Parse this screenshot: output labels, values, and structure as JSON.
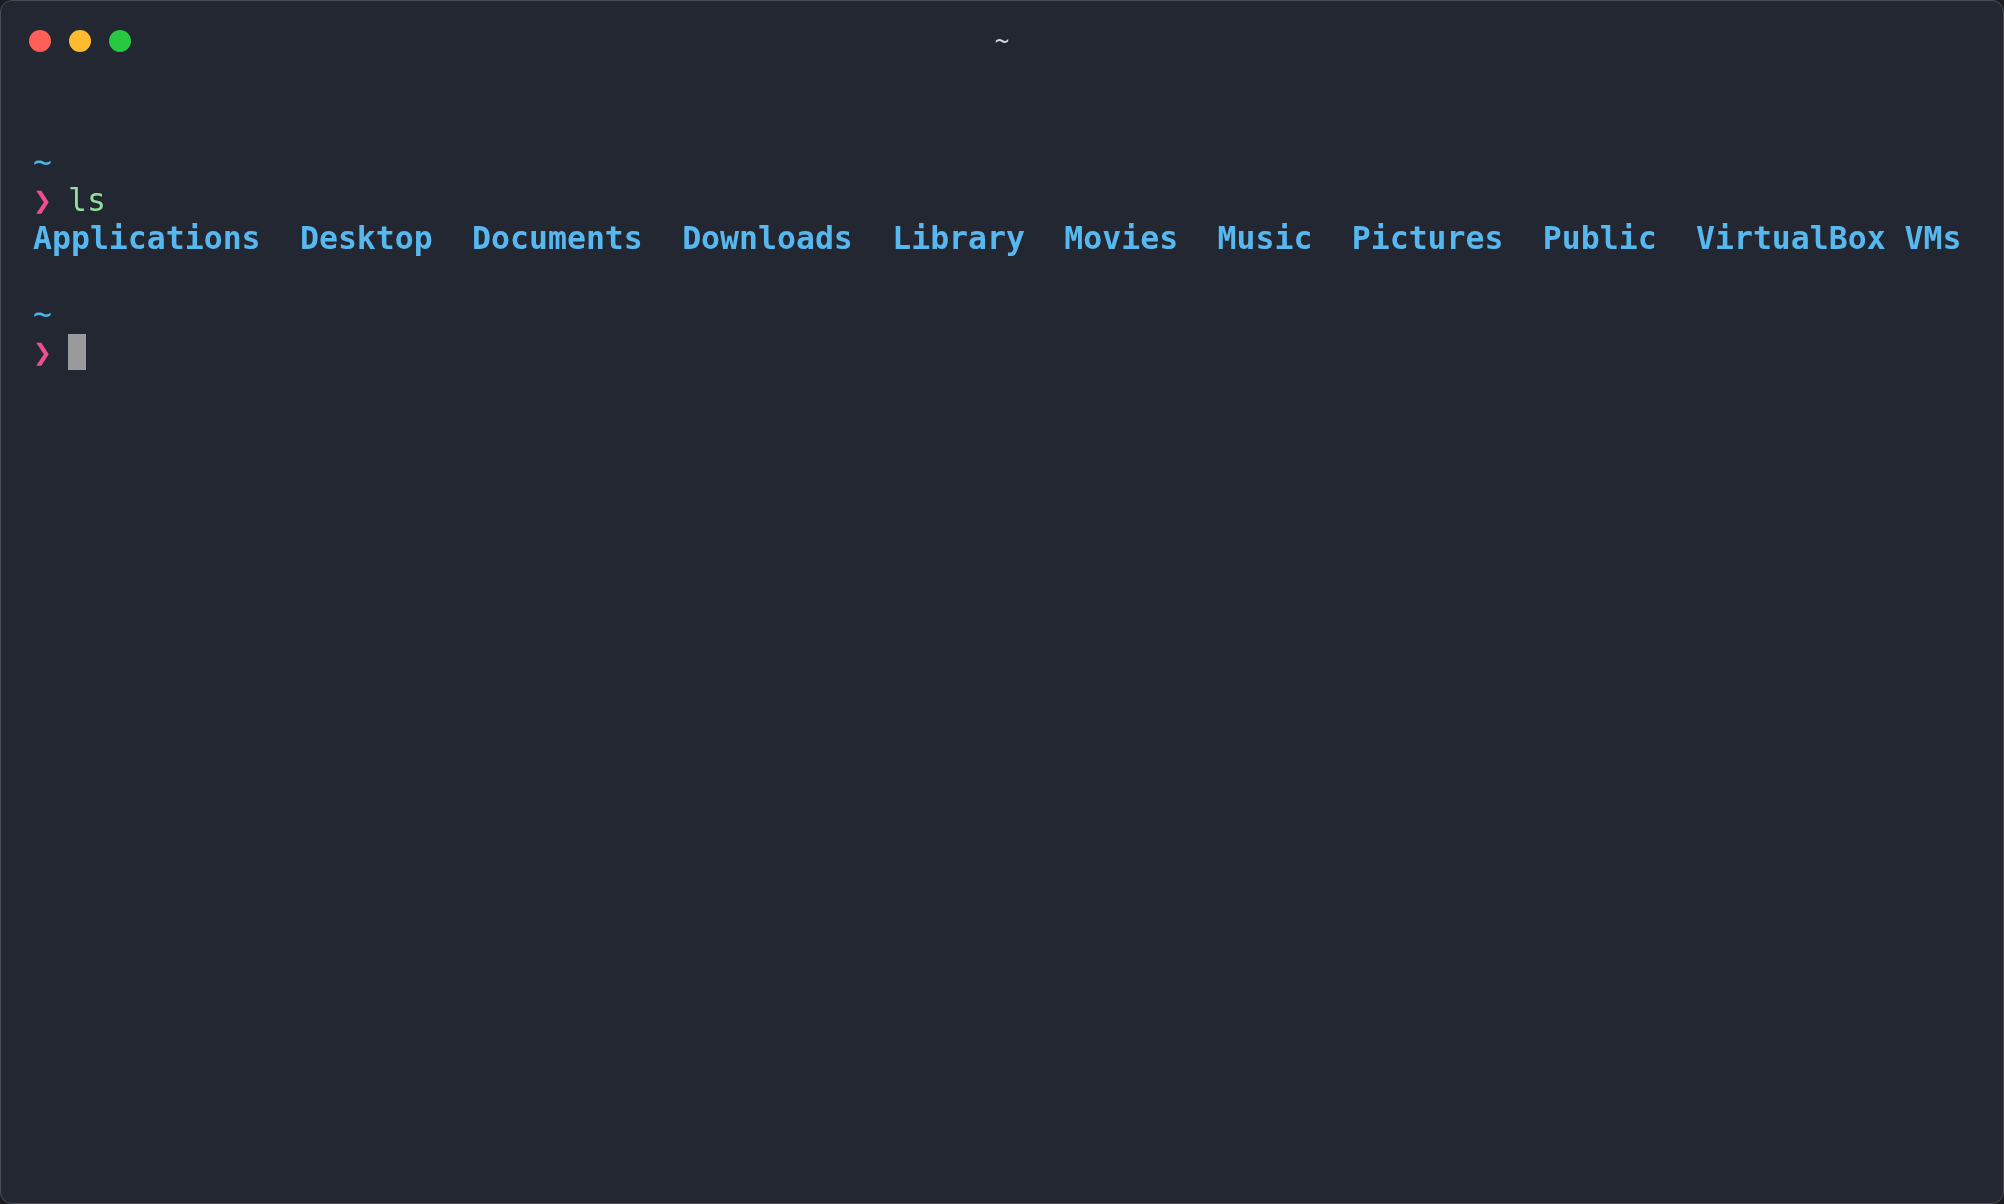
{
  "window": {
    "title": "~",
    "controls": [
      {
        "color": "#fe5f57"
      },
      {
        "color": "#febc2e"
      },
      {
        "color": "#28c840"
      }
    ]
  },
  "lines": [
    {
      "kind": "cwd",
      "text": "~"
    },
    {
      "kind": "prompt",
      "symbol": "❯",
      "command": "ls"
    },
    {
      "kind": "listing",
      "entries": [
        "Applications",
        "Desktop",
        "Documents",
        "Downloads",
        "Library",
        "Movies",
        "Music",
        "Pictures",
        "Public",
        "VirtualBox VMs"
      ]
    },
    {
      "kind": "blank"
    },
    {
      "kind": "cwd",
      "text": "~"
    },
    {
      "kind": "prompt",
      "symbol": "❯",
      "cursor": true
    }
  ]
}
